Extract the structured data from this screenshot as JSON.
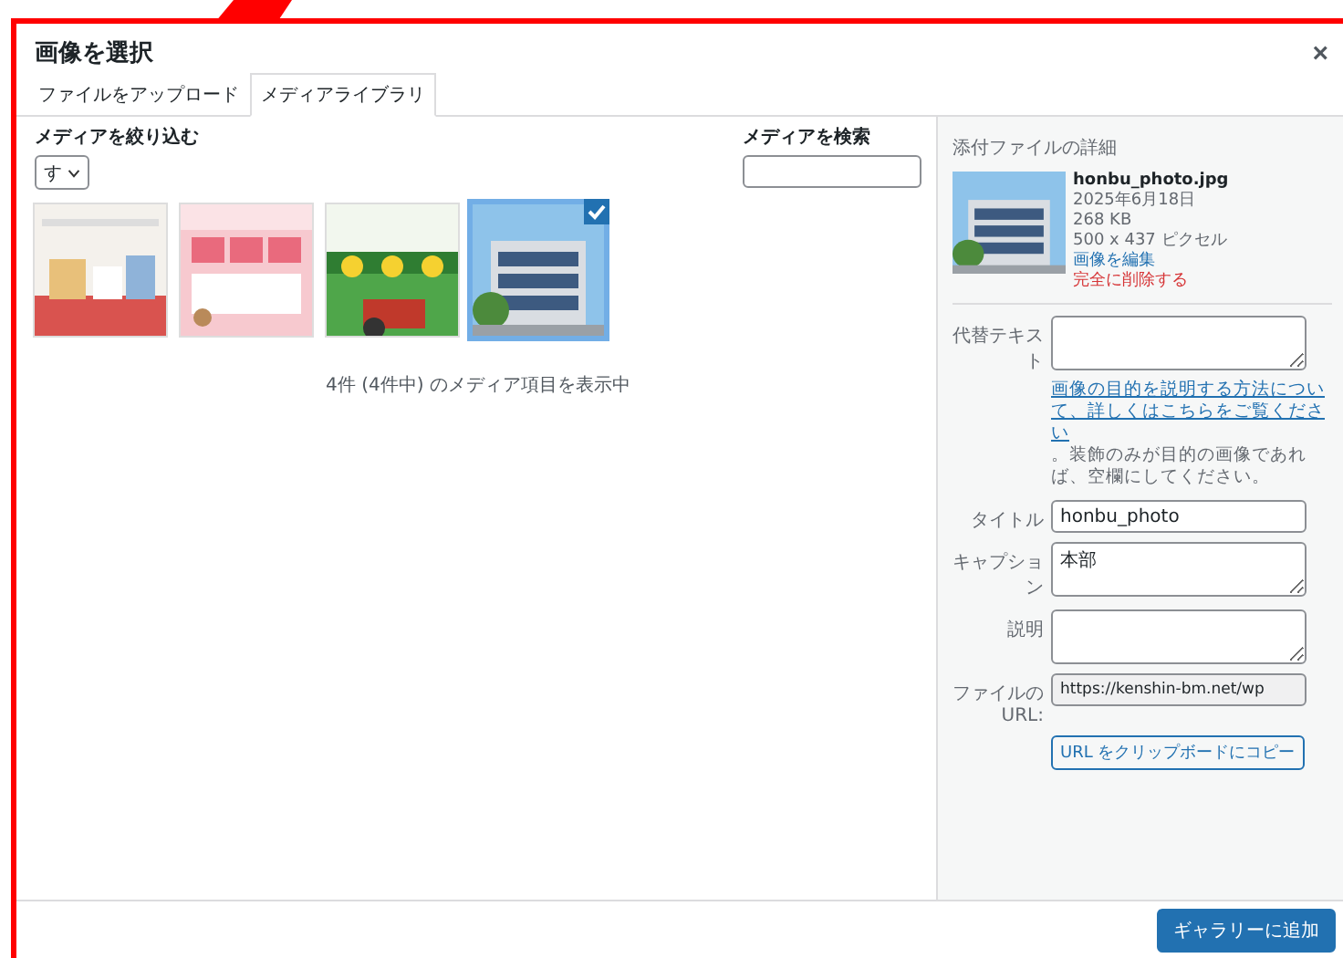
{
  "dialog": {
    "title": "画像を選択",
    "close": "×"
  },
  "tabs": [
    {
      "label": "ファイルをアップロード",
      "selected": false
    },
    {
      "label": "メディアライブラリ",
      "selected": true
    }
  ],
  "filter": {
    "label": "メディアを絞り込む",
    "value": "す"
  },
  "search": {
    "label": "メディアを検索"
  },
  "media": [
    {
      "kind": "picture",
      "selected": false
    },
    {
      "kind": "picture",
      "selected": false
    },
    {
      "kind": "picture",
      "selected": false
    },
    {
      "kind": "picture",
      "selected": true
    }
  ],
  "count": "4件 (4件中) のメディア項目を表示中",
  "details": {
    "heading": "添付ファイルの詳細",
    "filename": "honbu_photo.jpg",
    "date": "2025年6月18日",
    "size": "268 KB",
    "dimensions": "500 x 437 ピクセル",
    "edit_link": "画像を編集",
    "delete_link": "完全に削除する"
  },
  "alt": {
    "label": "代替テキスト",
    "hint_link": "画像の目的を説明する方法について、詳しくはこちらをご覧ください",
    "hint_text": "。装飾のみが目的の画像であれば、空欄にしてください。"
  },
  "fields": [
    {
      "kind": "input",
      "label": "タイトル",
      "value": "honbu_photo"
    },
    {
      "kind": "textarea",
      "label": "キャプション",
      "value": "本部"
    },
    {
      "kind": "textarea",
      "label": "説明"
    },
    {
      "kind": "readonly",
      "label": "ファイルの URL:",
      "value": "https://kenshin-bm.net/wp"
    }
  ],
  "copy_button": "URL をクリップボードにコピー",
  "primary_button": "ギャラリーに追加"
}
